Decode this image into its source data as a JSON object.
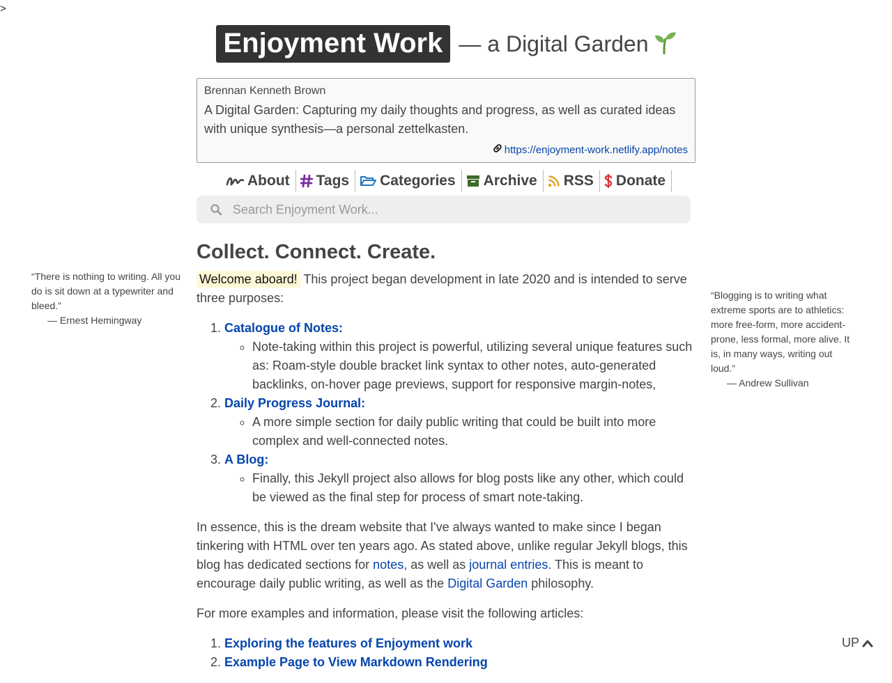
{
  "page": {
    "corner_mark": ">"
  },
  "header": {
    "title": "Enjoyment Work",
    "subtitle": "— a Digital Garden"
  },
  "author_card": {
    "name": "Brennan Kenneth Brown",
    "description": "A Digital Garden: Capturing my daily thoughts and progress, as well as curated ideas with unique synthesis—a personal zettelkasten.",
    "url": "https://enjoyment-work.netlify.app/notes"
  },
  "nav": {
    "items": [
      {
        "label": "About",
        "icon": "signature-icon",
        "color": "#444444"
      },
      {
        "label": "Tags",
        "icon": "hashtag-icon",
        "color": "#7b2d9e"
      },
      {
        "label": "Categories",
        "icon": "folder-open-icon",
        "color": "#1e73be"
      },
      {
        "label": "Archive",
        "icon": "archive-box-icon",
        "color": "#3d6b2a"
      },
      {
        "label": "RSS",
        "icon": "rss-icon",
        "color": "#e0a020"
      },
      {
        "label": "Donate",
        "icon": "dollar-icon",
        "color": "#d9363e"
      }
    ]
  },
  "search": {
    "placeholder": "Search Enjoyment Work..."
  },
  "content": {
    "heading": "Collect. Connect. Create.",
    "welcome": "Welcome aboard!",
    "intro": " This project began development in late 2020 and is intended to serve three purposes:",
    "purposes": [
      {
        "title": "Catalogue of Notes:",
        "detail": "Note-taking within this project is powerful, utilizing several unique features such as: Roam-style double bracket link syntax to other notes, auto-generated backlinks, on-hover page previews, support for responsive margin-notes,"
      },
      {
        "title": "Daily Progress Journal:",
        "detail": "A more simple section for daily public writing that could be built into more complex and well-connected notes."
      },
      {
        "title": "A Blog:",
        "detail": "Finally, this Jekyll project also allows for blog posts like any other, which could be viewed as the final step for process of smart note-taking."
      }
    ],
    "essence": {
      "part1": "In essence, this is the dream website that I've always wanted to make since I began tinkering with HTML over ten years ago. As stated above, unlike regular Jekyll blogs, this blog has dedicated sections for ",
      "link_notes": "notes",
      "part2": ", as well as ",
      "link_journal": "journal entries",
      "part3": ". This is meant to encourage daily public writing, as well as the ",
      "link_garden": "Digital Garden",
      "part4": " philosophy."
    },
    "more_intro": "For more examples and information, please visit the following articles:",
    "articles": [
      "Exploring the features of Enjoyment work",
      "Example Page to View Markdown Rendering"
    ]
  },
  "quotes": {
    "left": {
      "text": "“There is nothing to writing. All you do is sit down at a typewriter and bleed.”",
      "author": "— Ernest Hemingway"
    },
    "right": {
      "text": "“Blogging is to writing what extreme sports are to athletics: more free-form, more accident-prone, less formal, more alive. It is, in many ways, writing out loud.”",
      "author": "— Andrew Sullivan"
    }
  },
  "up_button": {
    "label": "UP"
  }
}
